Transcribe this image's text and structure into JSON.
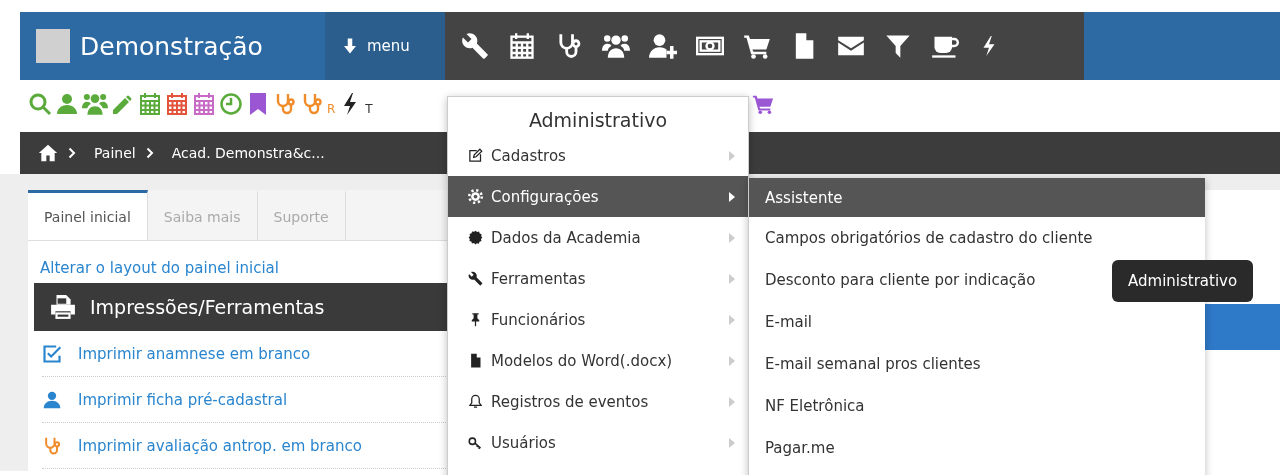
{
  "header": {
    "title": "Demonstração",
    "menu_button": "menu"
  },
  "quick_bar": {
    "stethoscope_label": "R",
    "bolt_label": "T"
  },
  "breadcrumb": [
    "Painel",
    "Acad. Demonstra&c..."
  ],
  "tabs": [
    {
      "label": "Painel inicial",
      "selected": true
    },
    {
      "label": "Saiba mais",
      "selected": false
    },
    {
      "label": "Suporte",
      "selected": false
    }
  ],
  "layout_link": "Alterar o layout do painel inicial",
  "panel": {
    "title": "Impressões/Ferramentas",
    "items": [
      {
        "label": "Imprimir anamnese em branco",
        "kind": "check"
      },
      {
        "label": "Imprimir ficha pré-cadastral",
        "kind": "user"
      },
      {
        "label": "Imprimir avaliação antrop. em branco",
        "kind": "stethoscope"
      }
    ]
  },
  "menu": {
    "title": "Administrativo",
    "items": [
      {
        "label": "Cadastros",
        "kind": "edit",
        "selected": false
      },
      {
        "label": "Configurações",
        "kind": "gear",
        "selected": true
      },
      {
        "label": "Dados da Academia",
        "kind": "badge",
        "selected": false
      },
      {
        "label": "Ferramentas",
        "kind": "wrench",
        "selected": false
      },
      {
        "label": "Funcionários",
        "kind": "pin",
        "selected": false
      },
      {
        "label": "Modelos do Word(.docx)",
        "kind": "file",
        "selected": false
      },
      {
        "label": "Registros de eventos",
        "kind": "bell",
        "selected": false
      },
      {
        "label": "Usuários",
        "kind": "key",
        "selected": false
      }
    ]
  },
  "submenu": {
    "items": [
      {
        "label": "Assistente",
        "selected": true
      },
      {
        "label": "Campos obrigatórios de cadastro do cliente",
        "selected": false
      },
      {
        "label": "Desconto para cliente por indicação",
        "selected": false
      },
      {
        "label": "E-mail",
        "selected": false
      },
      {
        "label": "E-mail semanal pros clientes",
        "selected": false
      },
      {
        "label": "NF Eletrônica",
        "selected": false
      },
      {
        "label": "Pagar.me",
        "selected": false
      }
    ]
  },
  "tooltip": "Administrativo"
}
